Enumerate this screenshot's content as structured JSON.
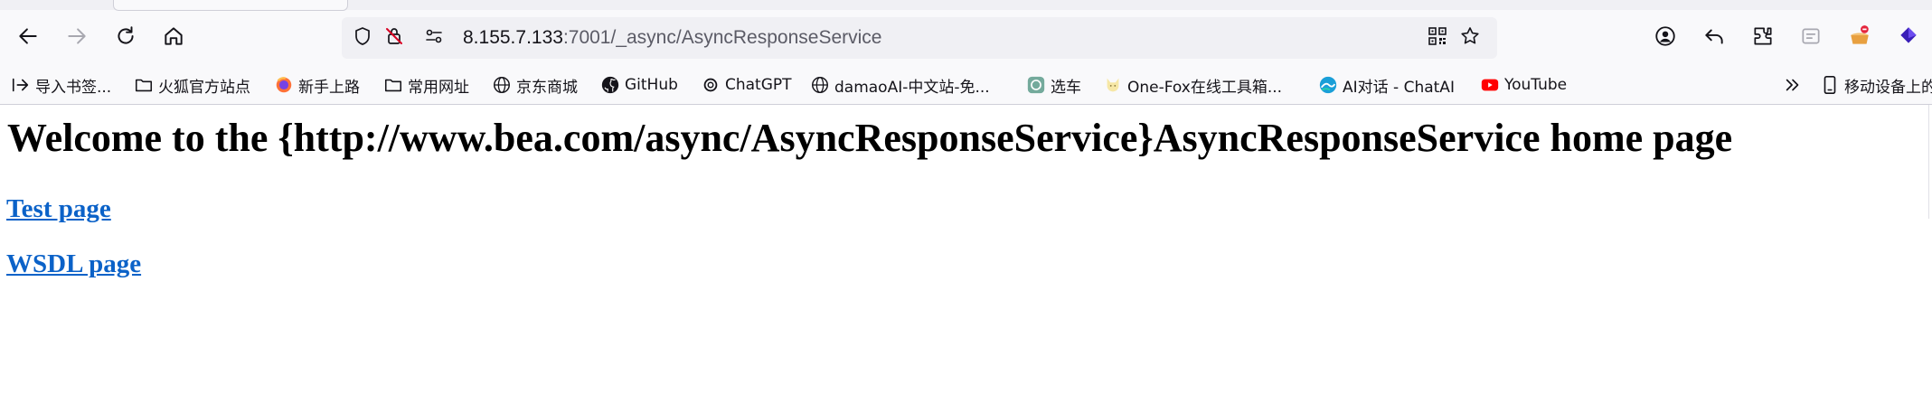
{
  "browser": {
    "url_host": "8.155.7.133",
    "url_rest": ":7001/_async/AsyncResponseService",
    "toolbar_icons": [
      "back-icon",
      "forward-icon",
      "reload-icon",
      "home-icon",
      "shield-icon",
      "blocked-permission-icon",
      "connection-info-icon",
      "qr-code-icon",
      "bookmark-star-icon",
      "account-icon",
      "undo-icon",
      "extensions-icon",
      "reader-view-icon",
      "extension-basket-icon",
      "extension-cube-icon"
    ],
    "accent_color": "#0b62c8"
  },
  "bookmarks": [
    {
      "label": "导入书签...",
      "icon": "import-icon"
    },
    {
      "label": "火狐官方站点",
      "icon": "folder-icon"
    },
    {
      "label": "新手上路",
      "icon": "firefox-icon"
    },
    {
      "label": "常用网址",
      "icon": "folder-icon"
    },
    {
      "label": "京东商城",
      "icon": "globe-icon"
    },
    {
      "label": "GitHub",
      "icon": "github-icon"
    },
    {
      "label": "ChatGPT",
      "icon": "openai-icon"
    },
    {
      "label": "damaoAI-中文站-免...",
      "icon": "globe-icon"
    },
    {
      "label": "选车",
      "icon": "openai-icon"
    },
    {
      "label": "One-Fox在线工具箱...",
      "icon": "fox-icon"
    },
    {
      "label": "AI对话 - ChatAI",
      "icon": "chatai-icon"
    },
    {
      "label": "YouTube",
      "icon": "youtube-icon"
    },
    {
      "label": "移动设备上的",
      "icon": "mobile-icon"
    }
  ],
  "page": {
    "heading": "Welcome to the {http://www.bea.com/async/AsyncResponseService}AsyncResponseService home page",
    "links": [
      {
        "label": "Test page"
      },
      {
        "label": "WSDL page"
      }
    ]
  }
}
